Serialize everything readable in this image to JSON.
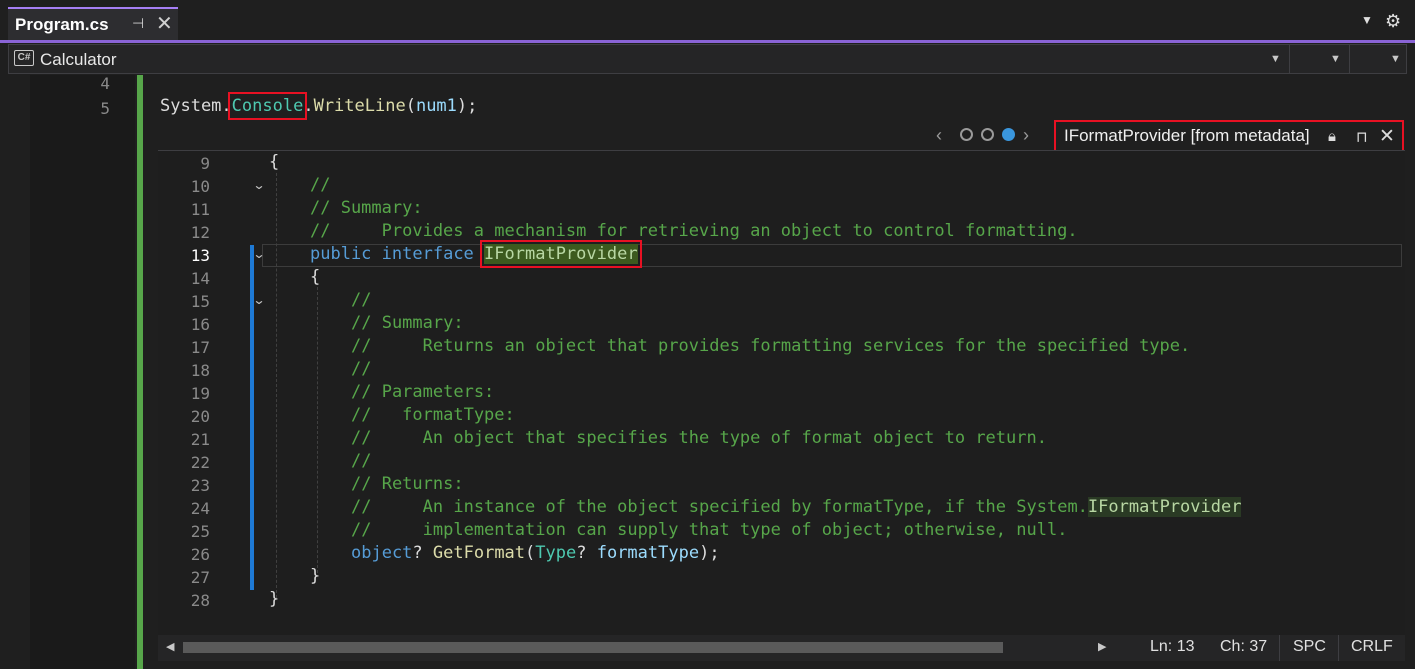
{
  "tab": {
    "title": "Program.cs",
    "pin_icon": "pin-icon",
    "close_icon": "close-icon"
  },
  "navbar": {
    "project": "Calculator",
    "project_icon_text": "C#"
  },
  "editor": {
    "outer_lines": [
      {
        "num": "4",
        "code": ""
      },
      {
        "num": "5",
        "code": "System.Console.WriteLine(num1);"
      }
    ],
    "code": {
      "ns": "System",
      "dot1": ".",
      "cls": "Console",
      "dot2": ".",
      "method": "WriteLine",
      "args_open": "(",
      "arg": "num1",
      "args_close": ");"
    }
  },
  "peek": {
    "title": "IFormatProvider [from metadata]",
    "nav_prev": "‹",
    "nav_next": "›",
    "dots": 3,
    "active_dot": 3,
    "lines": [
      {
        "num": "9",
        "text": "{"
      },
      {
        "num": "10",
        "text": "//"
      },
      {
        "num": "11",
        "text": "// Summary:"
      },
      {
        "num": "12",
        "text": "//     Provides a mechanism for retrieving an object to control formatting."
      },
      {
        "num": "13",
        "kw1": "public",
        "kw2": "interface",
        "type": "IFormatProvider"
      },
      {
        "num": "14",
        "text": "{"
      },
      {
        "num": "15",
        "text": "//"
      },
      {
        "num": "16",
        "text": "// Summary:"
      },
      {
        "num": "17",
        "text": "//     Returns an object that provides formatting services for the specified type."
      },
      {
        "num": "18",
        "text": "//"
      },
      {
        "num": "19",
        "text": "// Parameters:"
      },
      {
        "num": "20",
        "text": "//   formatType:"
      },
      {
        "num": "21",
        "text": "//     An object that specifies the type of format object to return."
      },
      {
        "num": "22",
        "text": "//"
      },
      {
        "num": "23",
        "text": "// Returns:"
      },
      {
        "num": "24",
        "text": "//     An instance of the object specified by formatType, if the System.",
        "type": "IFormatProvider"
      },
      {
        "num": "25",
        "text": "//     implementation can supply that type of object; otherwise, null."
      },
      {
        "num": "26",
        "kw": "object",
        "q1": "? ",
        "method": "GetFormat",
        "open": "(",
        "ptype": "Type",
        "q2": "? ",
        "param": "formatType",
        "close": ");"
      },
      {
        "num": "27",
        "text": "}"
      },
      {
        "num": "28",
        "text": "}"
      }
    ]
  },
  "status": {
    "ln": "Ln: 13",
    "ch": "Ch: 37",
    "spc": "SPC",
    "crlf": "CRLF"
  },
  "colors": {
    "accent": "#8a64d6",
    "comment": "#57a64a",
    "keyword": "#569cd6",
    "type": "#4ec9b0",
    "highlight_box": "#e81123",
    "change_bar": "#57a64a",
    "peek_bar": "#1e7ad6"
  }
}
